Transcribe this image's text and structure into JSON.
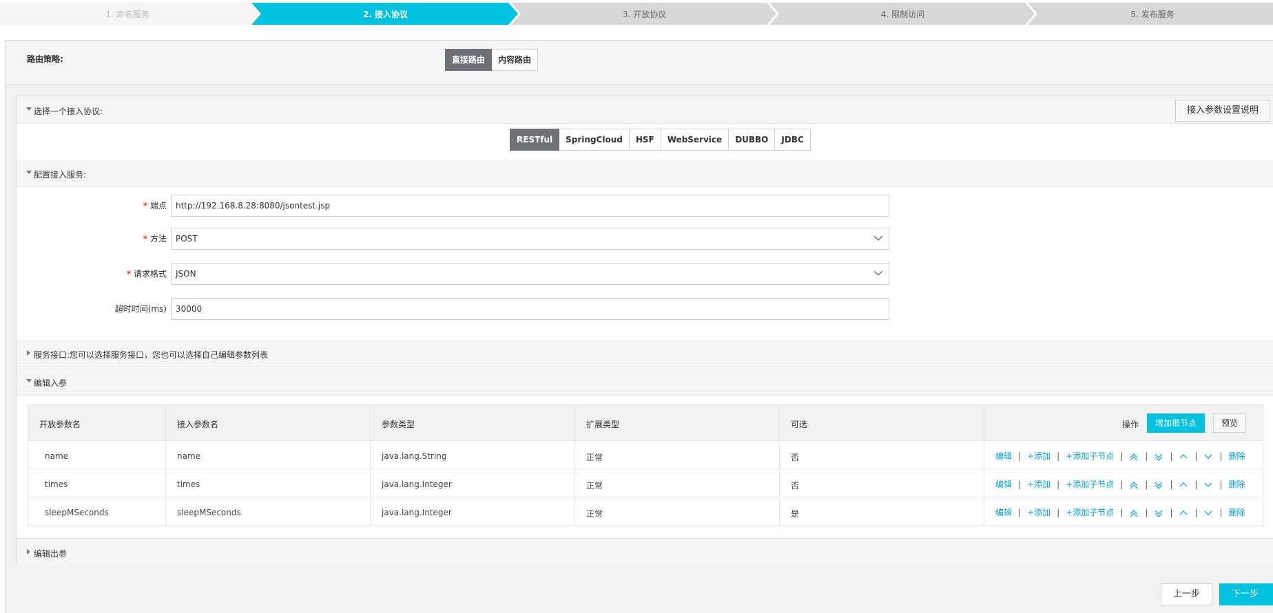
{
  "steps": [
    {
      "label": "1. 命名服务",
      "state": "done"
    },
    {
      "label": "2. 接入协议",
      "state": "active"
    },
    {
      "label": "3. 开放协议",
      "state": "todo"
    },
    {
      "label": "4. 限制访问",
      "state": "todo"
    },
    {
      "label": "5. 发布服务",
      "state": "todo"
    }
  ],
  "route": {
    "label": "路由策略:",
    "options": [
      "直接路由",
      "内容路由"
    ],
    "selected": "直接路由"
  },
  "protocol": {
    "title": "选择一个接入协议:",
    "help_button": "接入参数设置说明",
    "options": [
      "RESTful",
      "SpringCloud",
      "HSF",
      "WebService",
      "DUBBO",
      "JDBC"
    ],
    "selected": "RESTful"
  },
  "config": {
    "title": "配置接入服务:",
    "endpoint_label": "端点",
    "endpoint_value": "http://192.168.8.28:8080/jsontest.jsp",
    "method_label": "方法",
    "method_value": "POST",
    "format_label": "请求格式",
    "format_value": "JSON",
    "timeout_label": "超时时间(ms)",
    "timeout_value": "30000",
    "required_mark": "*"
  },
  "service_interface": {
    "title": "服务接口:您可以选择服务接口，您也可以选择自己编辑参数列表"
  },
  "input_params": {
    "title": "编辑入参",
    "columns": [
      "开放参数名",
      "接入参数名",
      "参数类型",
      "扩展类型",
      "可选",
      "操作"
    ],
    "add_root_button": "增加根节点",
    "preview_button": "预览",
    "rows": [
      {
        "open_name": "name",
        "access_name": "name",
        "type": "java.lang.String",
        "ext": "正常",
        "optional": "否"
      },
      {
        "open_name": "times",
        "access_name": "times",
        "type": "java.lang.Integer",
        "ext": "正常",
        "optional": "否"
      },
      {
        "open_name": "sleepMSeconds",
        "access_name": "sleepMSeconds",
        "type": "java.lang.Integer",
        "ext": "正常",
        "optional": "是"
      }
    ],
    "row_ops": {
      "edit": "编辑",
      "add": "+添加",
      "add_child": "+添加子节点",
      "delete": "删除",
      "separator": "|"
    }
  },
  "output_params": {
    "title": "编辑出参"
  },
  "footer": {
    "prev": "上一步",
    "next": "下一步"
  },
  "colors": {
    "accent": "#00c1de",
    "step_inactive": "#d8d8d8",
    "link": "#00a2d4",
    "selected_seg": "#6e7277"
  }
}
